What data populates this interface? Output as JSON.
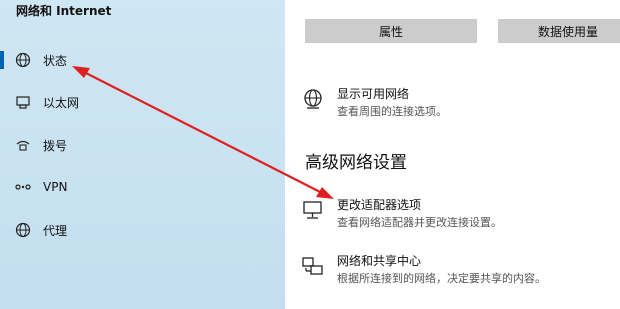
{
  "sidebar": {
    "header": "网络和 Internet",
    "items": [
      {
        "label": "状态",
        "icon": "globe-status-icon",
        "active": true
      },
      {
        "label": "以太网",
        "icon": "ethernet-icon",
        "active": false
      },
      {
        "label": "拨号",
        "icon": "dialup-icon",
        "active": false
      },
      {
        "label": "VPN",
        "icon": "vpn-icon",
        "active": false
      },
      {
        "label": "代理",
        "icon": "globe-proxy-icon",
        "active": false
      }
    ]
  },
  "main": {
    "buttons": {
      "properties": "属性",
      "data_usage": "数据使用量"
    },
    "show_networks": {
      "title": "显示可用网络",
      "desc": "查看周围的连接选项。"
    },
    "advanced_title": "高级网络设置",
    "change_adapter": {
      "title": "更改适配器选项",
      "desc": "查看网络适配器并更改连接设置。"
    },
    "sharing_center": {
      "title": "网络和共享中心",
      "desc": "根据所连接到的网络，决定要共享的内容。"
    }
  },
  "annotation": {
    "color": "#e02020"
  }
}
